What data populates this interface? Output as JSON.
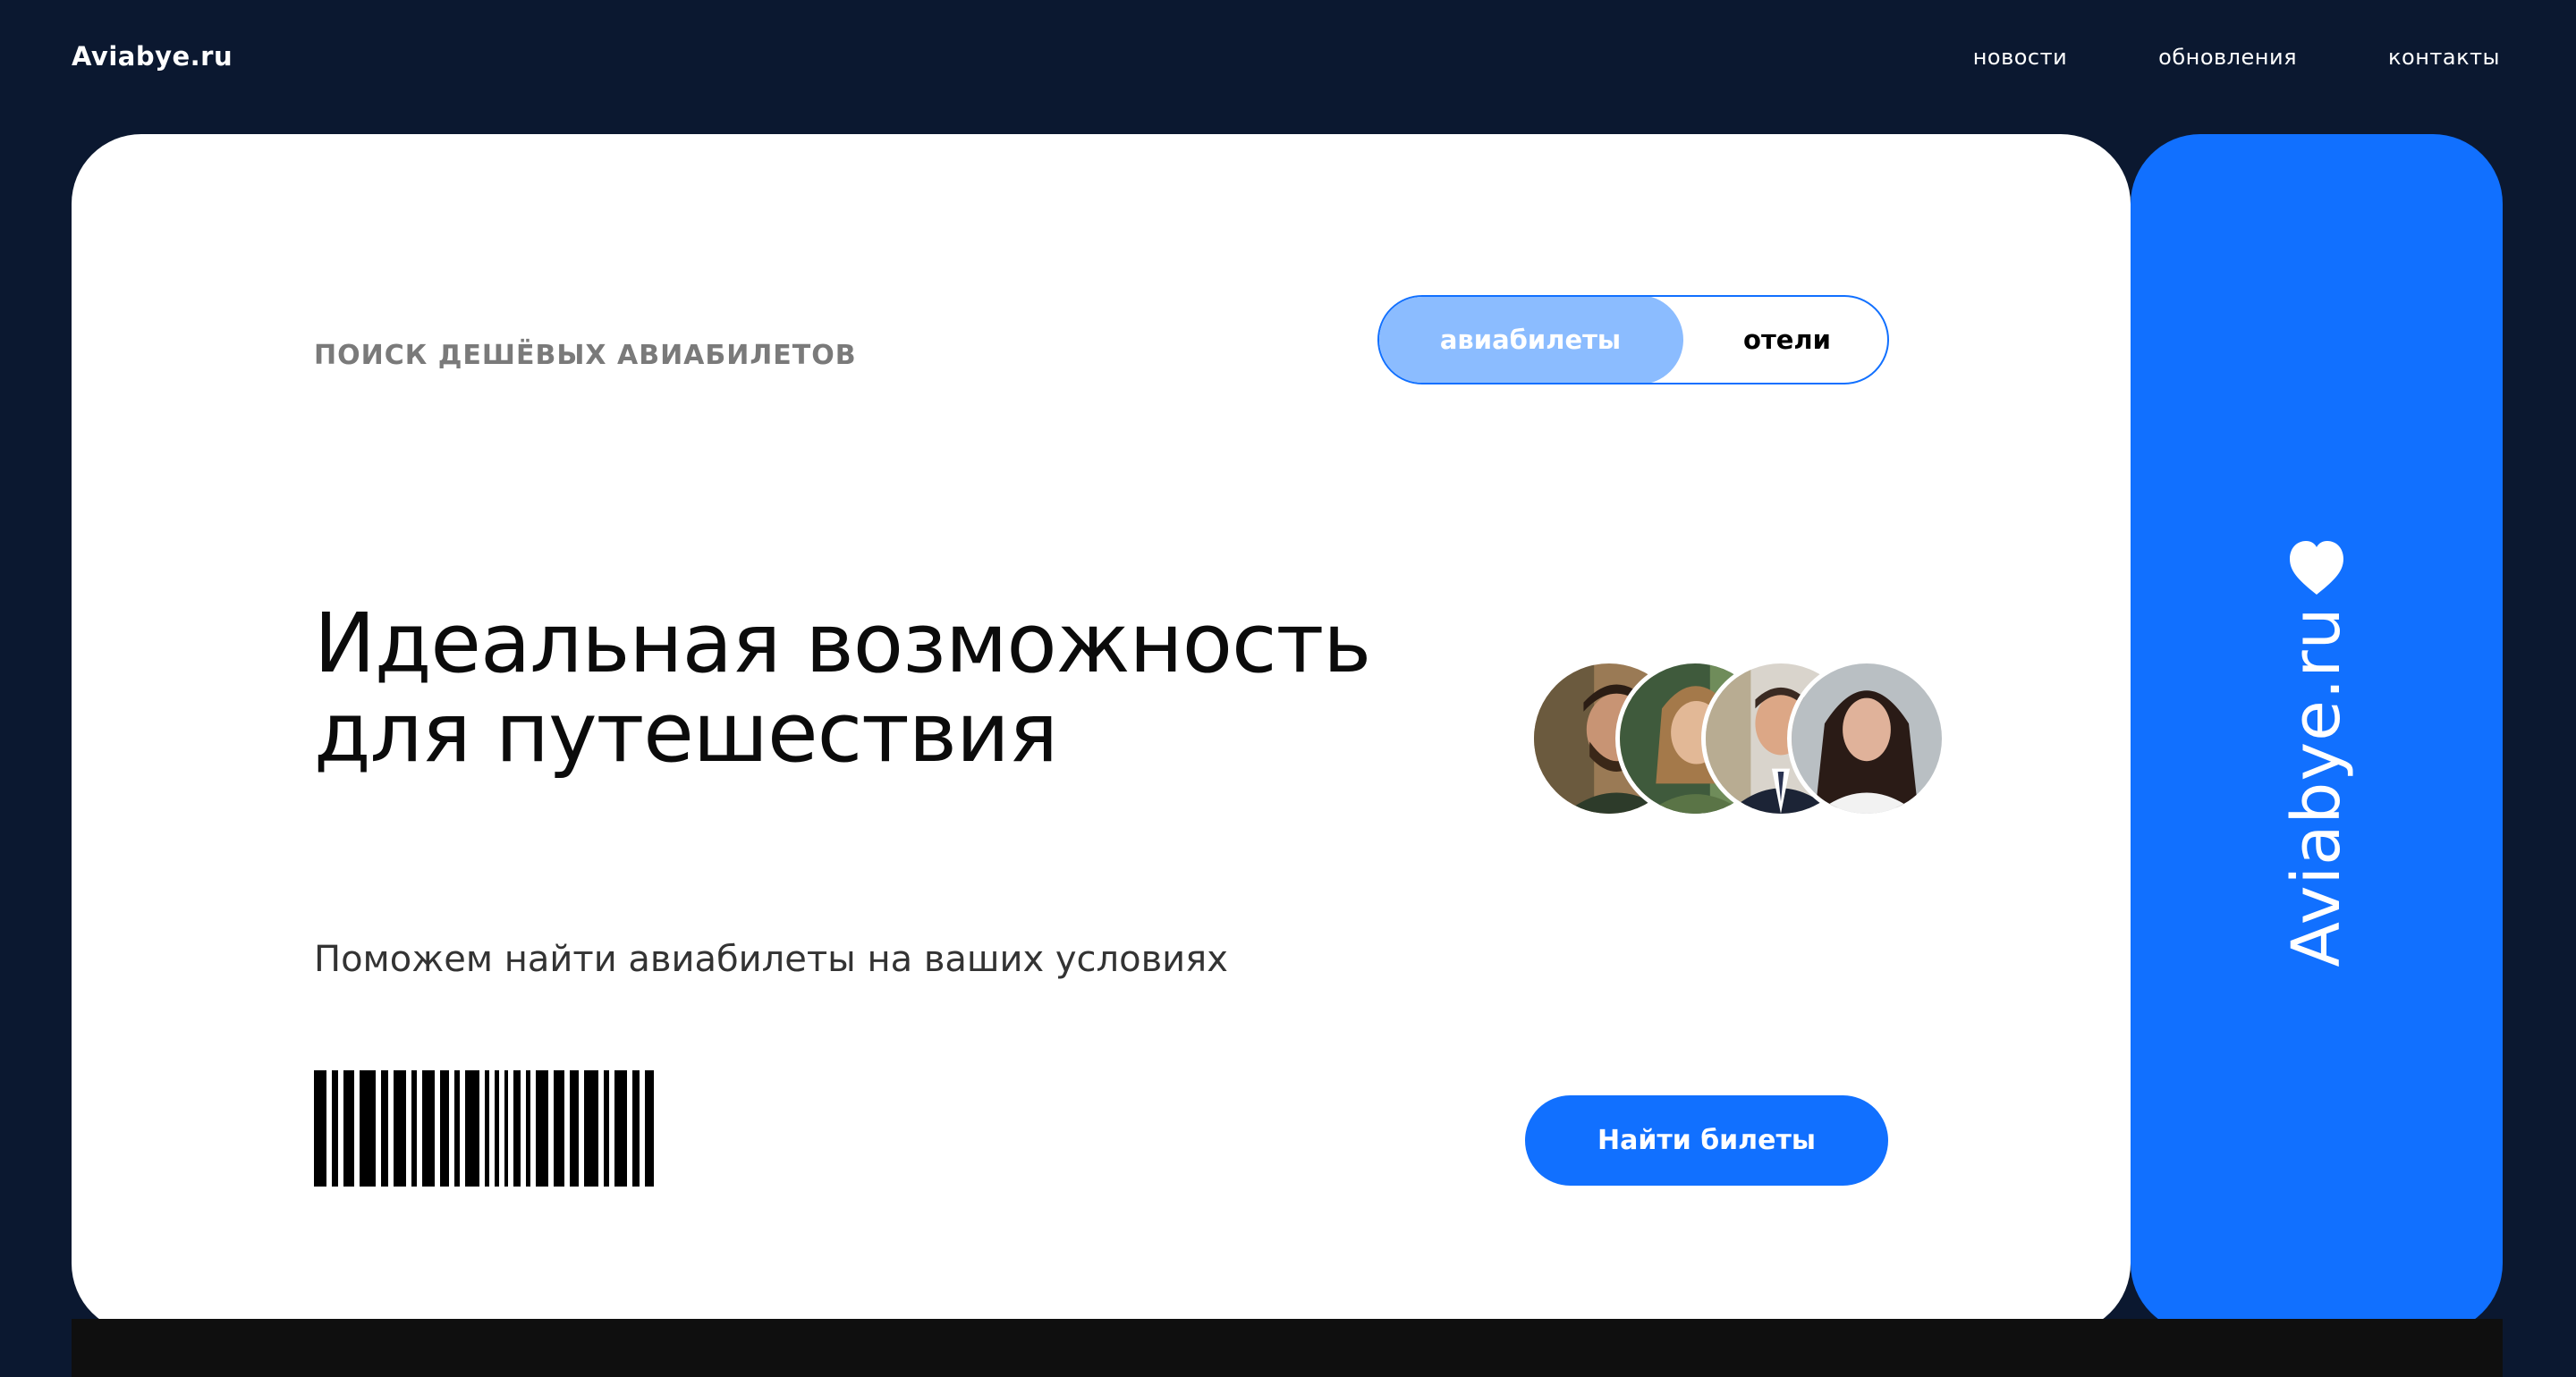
{
  "header": {
    "logo": "Aviabye.ru",
    "nav": [
      {
        "label": "новости"
      },
      {
        "label": "обновления"
      },
      {
        "label": "контакты"
      }
    ]
  },
  "card": {
    "eyebrow": "ПОИСК ДЕШЁВЫХ АВИАБИЛЕТОВ",
    "toggle": {
      "active_label": "авиабилеты",
      "inactive_label": "отели"
    },
    "headline_line1": "Идеальная возможность",
    "headline_line2": "для путешествия",
    "subtitle": "Поможем найти авиабилеты на ваших условиях",
    "cta_label": "Найти билеты",
    "avatars": [
      {
        "icon": "person-avatar-bearded-man"
      },
      {
        "icon": "person-avatar-smiling-woman"
      },
      {
        "icon": "person-avatar-man-in-suit"
      },
      {
        "icon": "person-avatar-dark-haired-woman"
      }
    ],
    "barcode_icon": "barcode-icon"
  },
  "stub": {
    "brand_text": "Aviabye.ru",
    "icon": "heart-icon"
  },
  "colors": {
    "background": "#0b1830",
    "accent": "#1170ff",
    "accent_light": "#8bbcff",
    "card": "#ffffff"
  }
}
